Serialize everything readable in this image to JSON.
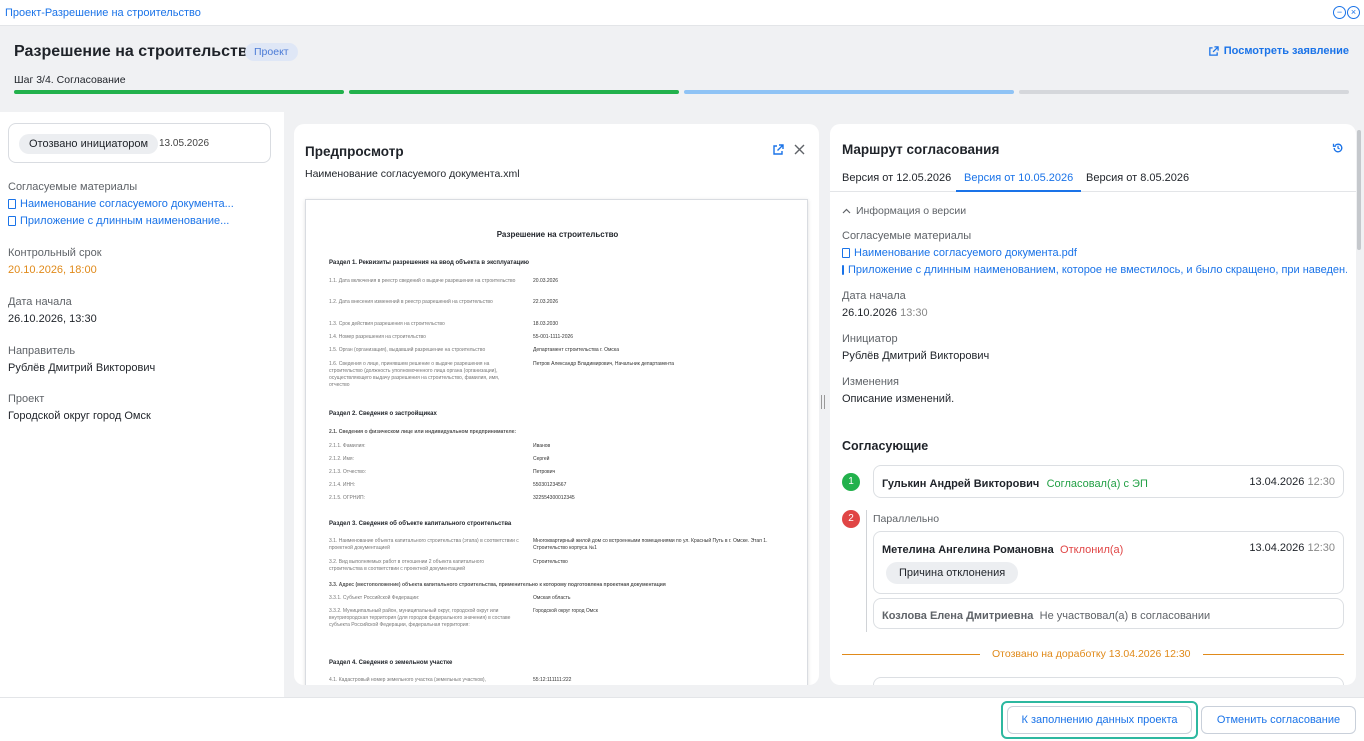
{
  "window": {
    "title": "Проект-Разрешение на строительство"
  },
  "header": {
    "title": "Разрешение на строительство",
    "badge": "Проект",
    "view_link": "Посмотреть заявление",
    "step": "Шаг 3/4. Согласование",
    "steps_status": [
      "done",
      "done",
      "current",
      "pending"
    ]
  },
  "left": {
    "status": "Отозвано инициатором",
    "status_date": "13.05.2026",
    "materials_label": "Согласуемые материалы",
    "materials": [
      "Наименование согласуемого документа...",
      "Приложение с длинным наименование..."
    ],
    "deadline_label": "Контрольный срок",
    "deadline": "20.10.2026, 18:00",
    "start_label": "Дата начала",
    "start": "26.10.2026, 13:30",
    "sender_label": "Направитель",
    "sender": "Рублёв Дмитрий Викторович",
    "project_label": "Проект",
    "project": "Городской округ город Омск"
  },
  "preview": {
    "title": "Предпросмотр",
    "filename": "Наименование согласуемого документа.xml",
    "doc": {
      "heading": "Разрешение на строительство",
      "s1": "Раздел 1. Реквизиты разрешения на ввод объекта в эксплуатацию",
      "r1": [
        [
          "1.1. Дата включения в реестр сведений о выдаче разрешения на строительство",
          "20.03.2026"
        ],
        [
          "1.2. Дата внесения изменений в реестр разрешений на строительство",
          "22.03.2026"
        ],
        [
          "1.3. Срок действия разрешения на строительство",
          "18.03.2030"
        ],
        [
          "1.4. Номер разрешения на строительство",
          "55-001-1111-2026"
        ],
        [
          "1.5. Орган (организация), выдавший разрешение на строительство",
          "Департамент строительства г. Омска"
        ],
        [
          "1.6. Сведения о лице, принявшем решение о выдаче разрешения на строительство (должность уполномоченного лица органа (организации), осуществляющего выдачу разрешения на строительство, фамилия, имя, отчество",
          "Петров Александр Владимирович, Начальник департамента"
        ]
      ],
      "s2": "Раздел 2. Сведения о застройщиках",
      "s2sub": "2.1. Сведения о физическом лице или индивидуальном предпринимателе:",
      "r2": [
        [
          "2.1.1. Фамилия:",
          "Иванов"
        ],
        [
          "2.1.2. Имя:",
          "Сергей"
        ],
        [
          "2.1.3. Отчество:",
          "Петрович"
        ],
        [
          "2.1.4. ИНН:",
          "550301234567"
        ],
        [
          "2.1.5. ОГРНИП:",
          "322554300012345"
        ]
      ],
      "s3": "Раздел 3. Сведения об объекте капитального строительства",
      "r3": [
        [
          "3.1. Наименование объекта капитального строительства (этапа) в соответствии с проектной документацией",
          "Многоквартирный жилой дом со встроенными помещениями по ул. Красный Путь в г. Омске. Этап 1. Строительство корпуса №1"
        ],
        [
          "3.2. Вид выполняемых работ в отношении 2 объекта капитального строительства в соответствии с проектной документацией",
          "Строительство"
        ]
      ],
      "s3sub": "3.3. Адрес (местоположение) объекта капитального строительства, применительно к которому подготовлена проектная документация",
      "r3b": [
        [
          "3.3.1. Субъект Российской Федерации:",
          "Омская область"
        ],
        [
          "3.3.2. Муниципальный район, муниципальный округ, городской округ или внутригородская территория (для городов федерального значения) в составе субъекта Российской Федерации, федеральная территория:",
          "Городской округ город Омск"
        ]
      ],
      "s4": "Раздел 4. Сведения о земельном участке",
      "r4": [
        [
          "4.1. Кадастровый номер земельного участка (земельных участков),",
          "55:12:111111:222"
        ]
      ]
    }
  },
  "route": {
    "title": "Маршрут согласования",
    "tabs": [
      "Версия от 12.05.2026",
      "Версия от 10.05.2026",
      "Версия от 8.05.2026"
    ],
    "active_tab": 1,
    "info_toggle": "Информация о версии",
    "materials_label": "Согласуемые материалы",
    "materials": [
      "Наименование согласуемого документа.pdf",
      "Приложение с длинным наименованием, которое не вместилось, и было скращено, при наведен..."
    ],
    "start_label": "Дата начала",
    "start_date": "26.10.2026",
    "start_time": "13:30",
    "initiator_label": "Инициатор",
    "initiator": "Рублёв Дмитрий Викторович",
    "changes_label": "Изменения",
    "changes": "Описание изменений.",
    "approvers_title": "Согласующие",
    "approvers": [
      {
        "num": "1",
        "name": "Гулькин Андрей Викторович",
        "status": "Согласовал(а) с ЭП",
        "date": "13.04.2026",
        "time": "12:30"
      }
    ],
    "group2": {
      "num": "2",
      "label": "Параллельно",
      "a": {
        "name": "Метелина Ангелина Романовна",
        "status": "Отклонил(а)",
        "date": "13.04.2026",
        "time": "12:30",
        "reason": "Причина отклонения"
      },
      "b": {
        "name": "Козлова Елена Дмитриевна",
        "status": "Не участвовал(а) в согласовании"
      }
    },
    "recalled": "Отозвано на доработку 13.04.2026 12:30"
  },
  "footer": {
    "primary": "К заполнению данных проекта",
    "cancel": "Отменить согласование"
  },
  "colors": {
    "accent": "#1a73e8",
    "green": "#22b14c",
    "light_blue": "#8fc3f5",
    "red": "#e04545",
    "orange": "#e08a1a"
  }
}
